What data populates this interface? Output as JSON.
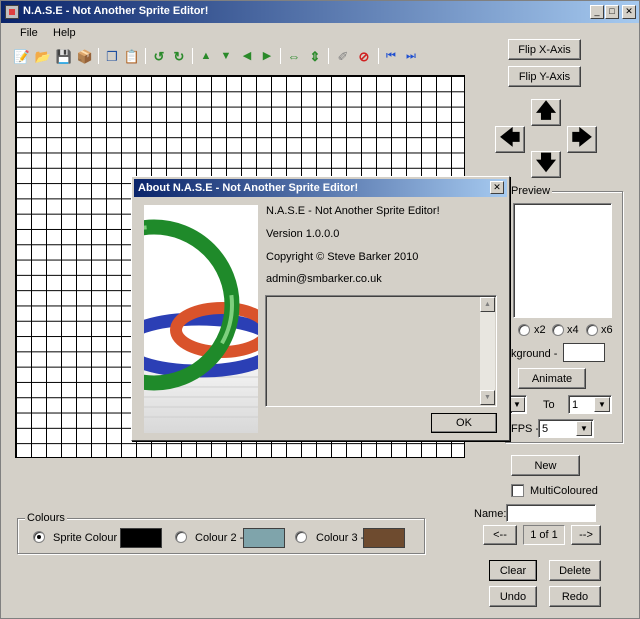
{
  "window": {
    "title": "N.A.S.E - Not Another Sprite Editor!",
    "minimize": "_",
    "maximize": "□",
    "close": "✕"
  },
  "menu": [
    {
      "label": "File"
    },
    {
      "label": "Help"
    }
  ],
  "toolbar": [
    {
      "icon": "new-icon",
      "glyph": "📝"
    },
    {
      "icon": "open-icon",
      "glyph": "📂"
    },
    {
      "icon": "save-icon",
      "glyph": "💾"
    },
    {
      "icon": "export-icon",
      "glyph": "📦"
    },
    {
      "icon": "copy-icon",
      "glyph": "❐"
    },
    {
      "icon": "paste-icon",
      "glyph": "📋"
    },
    {
      "icon": "rotate-left-icon",
      "glyph": "↺"
    },
    {
      "icon": "rotate-right-icon",
      "glyph": "↻"
    },
    {
      "icon": "shift-up-icon",
      "glyph": "▲"
    },
    {
      "icon": "shift-down-icon",
      "glyph": "▼"
    },
    {
      "icon": "shift-left-icon",
      "glyph": "◀"
    },
    {
      "icon": "shift-right-icon",
      "glyph": "▶"
    },
    {
      "icon": "flip-horizontal-icon",
      "glyph": "⇔"
    },
    {
      "icon": "flip-vertical-icon",
      "glyph": "⇕"
    },
    {
      "icon": "eraser-icon",
      "glyph": "✐"
    },
    {
      "icon": "stop-icon",
      "glyph": "⊘"
    },
    {
      "icon": "first-frame-icon",
      "glyph": "⏮"
    },
    {
      "icon": "last-frame-icon",
      "glyph": "⏭"
    }
  ],
  "buttons": {
    "flip_x": "Flip X-Axis",
    "flip_y": "Flip Y-Axis",
    "animate": "Animate",
    "new": "New",
    "prev": "<--",
    "next": "-->",
    "clear": "Clear",
    "delete": "Delete",
    "undo": "Undo",
    "redo": "Redo"
  },
  "arrows": {
    "up": "🡅",
    "down": "🡇",
    "left": "🡄",
    "right": "🡆"
  },
  "preview": {
    "label": "Preview",
    "zoom_x2": "x2",
    "zoom_x4": "x4",
    "zoom_x6": "x6",
    "background_label": "kground -",
    "to_label": "To",
    "to_value": "1",
    "fps_label": "FPS -",
    "fps_value": "5"
  },
  "multicoloured_label": "MultiColoured",
  "name_label": "Name:",
  "name_value": "",
  "page_indicator": "1 of 1",
  "colours": {
    "label": "Colours",
    "sprite_label": "Sprite Colour -",
    "sprite_color": "#000000",
    "colour2_label": "Colour 2 -",
    "colour2_color": "#7fa4ab",
    "colour3_label": "Colour 3 -",
    "colour3_color": "#6e4b2f"
  },
  "about": {
    "title": "About N.A.S.E - Not Another Sprite Editor!",
    "close": "✕",
    "product": "N.A.S.E - Not Another Sprite Editor!",
    "version": "Version 1.0.0.0",
    "copyright": "Copyright © Steve Barker 2010",
    "email": "admin@smbarker.co.uk",
    "ok": "OK"
  }
}
